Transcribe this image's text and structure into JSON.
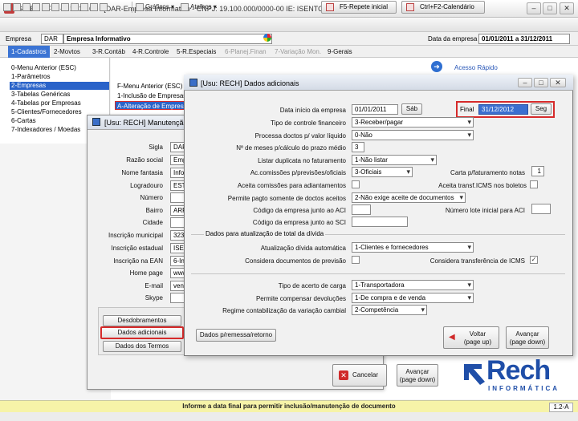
{
  "window": {
    "title": "SIGER - FIN - v.11.20.00 - [DAR-Empresa Informativo - CNPJ: 19.100.000/0000-00 IE: ISENTO ]",
    "minimize": "–",
    "maximize": "□",
    "close": "✕"
  },
  "toolbar": {
    "graficos": "Gráficos",
    "atalhos": "Atalhos",
    "f5_label": "F5-Repete inicial",
    "f2_label": "Ctrl+F2-Calendário"
  },
  "empresa": {
    "label": "Empresa",
    "code": "DAR",
    "name": "Empresa Informativo",
    "date_label": "Data da empresa",
    "date_range": "01/01/2011 a 31/12/2011"
  },
  "menu": {
    "items": [
      {
        "label": "1-Cadastros",
        "state": "active"
      },
      {
        "label": "2-Movtos",
        "state": "normal"
      },
      {
        "label": "3-R.Contáb",
        "state": "normal"
      },
      {
        "label": "4-R.Controle",
        "state": "normal"
      },
      {
        "label": "5-R.Especiais",
        "state": "normal"
      },
      {
        "label": "6-Planej.Finan",
        "state": "dim"
      },
      {
        "label": "7-Variação Mon.",
        "state": "dim"
      },
      {
        "label": "9-Gerais",
        "state": "normal"
      }
    ]
  },
  "cadastros": {
    "items": [
      "0-Menu Anterior (ESC)",
      "1-Parâmetros",
      "2-Empresas",
      "3-Tabelas Genéricas",
      "4-Tabelas por Empresas",
      "5-Clientes/Fornecedores",
      "6-Cartas",
      "7-Indexadores / Moedas"
    ],
    "selected": "2-Empresas"
  },
  "empresas_sub": {
    "items": [
      "F-Menu Anterior (ESC)",
      "1-Inclusão de Empresas",
      "A-Alteração de Empresa"
    ]
  },
  "quick_access": "Acesso Rápido",
  "manutencao": {
    "title": "[Usu: RECH] Manutenção",
    "labels": [
      "Sigla",
      "Razão social",
      "Nome fantasia",
      "Logradouro",
      "Número",
      "Bairro",
      "Cidade",
      "Inscrição municipal",
      "Inscrição estadual",
      "Inscrição na EAN",
      "Home page",
      "E-mail",
      "Skype"
    ],
    "values": [
      "DAR",
      "Empr",
      "Infor",
      "ESTR",
      "",
      "ARR",
      "",
      "3233",
      "ISEN",
      "6-Ins",
      "www",
      "vend",
      ""
    ],
    "btn_desdobramentos": "Desdobramentos",
    "btn_dados_adicionais": "Dados adicionais",
    "btn_dados_termos": "Dados dos Termos",
    "btn_cancelar": "Cancelar",
    "btn_avancar": "Avançar",
    "btn_avancar_sub": "(page down)"
  },
  "dados": {
    "title": "[Usu: RECH] Dados adicionais",
    "inicio_label": "Data início da empresa",
    "inicio_value": "01/01/2011",
    "inicio_day": "Sáb",
    "final_label": "Final",
    "final_value": "31/12/2012",
    "final_day": "Seg",
    "tipo_controle_label": "Tipo de controle financeiro",
    "tipo_controle_value": "3-Receber/pagar",
    "processa_label": "Processa doctos p/ valor líquido",
    "processa_value": "0-Não",
    "meses_label": "Nº de meses p/cálculo do prazo médio",
    "meses_value": "3",
    "listar_label": "Listar duplicata no faturamento",
    "listar_value": "1-Não listar",
    "comissoes_label": "Ac.comissões p/previsões/oficiais",
    "comissoes_value": "3-Oficiais",
    "carta_label": "Carta p/faturamento notas",
    "carta_value": "1",
    "aceita_comissoes_label": "Aceita comissões para adiantamentos",
    "aceita_icms_label": "Aceita transf.ICMS nos boletos",
    "permite_pagto_label": "Permite pagto somente de doctos aceitos",
    "permite_pagto_value": "2-Não exige aceite de documentos",
    "codigo_aci_label": "Código da empresa junto ao ACI",
    "codigo_aci_value": "",
    "numero_lote_label": "Número lote inicial para ACI",
    "numero_lote_value": "",
    "codigo_sci_label": "Código da empresa junto ao SCI",
    "codigo_sci_value": "",
    "section_divida": "Dados para atualização de total da dívida",
    "atualizacao_label": "Atualização dívida automática",
    "atualizacao_value": "1-Clientes e fornecedores",
    "considera_prev_label": "Considera documentos de previsão",
    "considera_icms_label": "Considera transferência de ICMS",
    "considera_icms_checked": "✓",
    "acerto_carga_label": "Tipo de acerto de carga",
    "acerto_carga_value": "1-Transportadora",
    "permite_dev_label": "Permite compensar devoluções",
    "permite_dev_value": "1-De compra e de venda",
    "regime_label": "Regime contabilização da variação cambial",
    "regime_value": "2-Competência",
    "btn_remessa": "Dados p/remessa/retorno",
    "btn_voltar": "Voltar",
    "btn_voltar_sub": "(page up)",
    "btn_avancar": "Avançar",
    "btn_avancar_sub": "(page down)"
  },
  "status": {
    "message": "Informe a data final para permitir inclusão/manutenção de documento",
    "code": "1.2-A"
  },
  "logo": {
    "name": "Rech",
    "sub": "INFORMÁTICA"
  },
  "colors": {
    "accent": "#3b74d4",
    "highlight_red": "#d62b2b",
    "status_yellow": "#f6f3a8",
    "logo_blue": "#1f4ea8"
  }
}
